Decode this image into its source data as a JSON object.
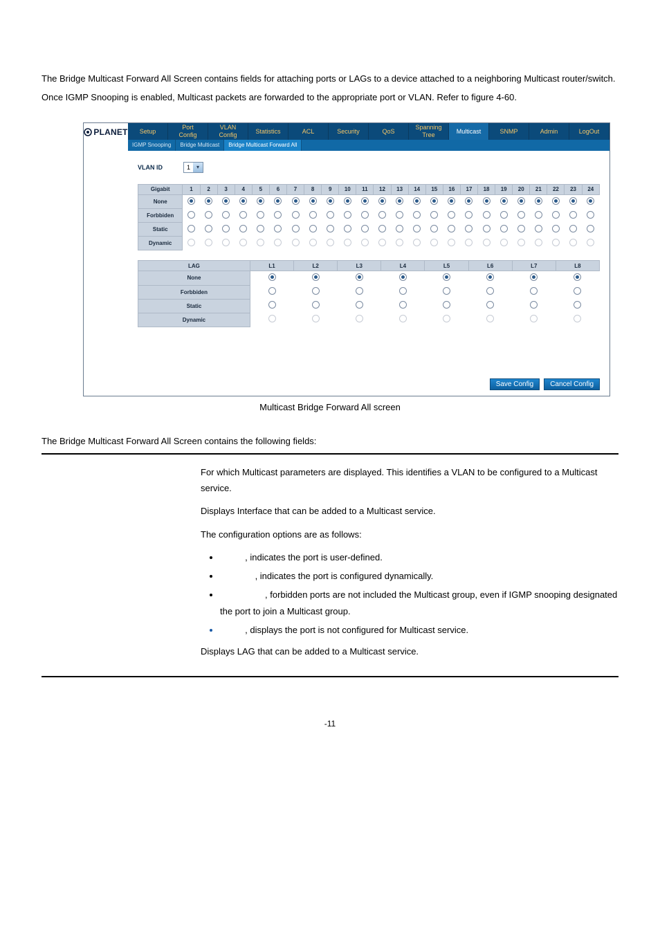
{
  "intro": "The Bridge Multicast Forward All Screen contains fields for attaching ports or LAGs to a device attached to a neighboring Multicast router/switch. Once IGMP Snooping is enabled, Multicast packets are forwarded to the appropriate port or VLAN. Refer to figure 4-60.",
  "logo_text": "PLANET",
  "menubar": [
    "Setup",
    "Port Config",
    "VLAN Config",
    "Statistics",
    "ACL",
    "Security",
    "QoS",
    "Spanning Tree",
    "Multicast",
    "SNMP",
    "Admin",
    "LogOut"
  ],
  "menubar_active": 8,
  "submenubar": [
    "IGMP Snooping",
    "Bridge Multicast",
    "Bridge Multicast Forward All"
  ],
  "submenubar_active": 2,
  "vlan_label": "VLAN ID",
  "vlan_value": "1",
  "gigabit_header": "Gigabit",
  "lag_header": "LAG",
  "row_labels": [
    "None",
    "Forbbiden",
    "Static",
    "Dynamic"
  ],
  "gigabit_cols": 24,
  "gigabit_selected_row": 0,
  "gigabit_disabled_row": 3,
  "lag_cols": 8,
  "lag_col_prefix": "L",
  "lag_selected_row": 0,
  "lag_disabled_row": 3,
  "buttons": {
    "save": "Save Config",
    "cancel": "Cancel Config"
  },
  "caption": "Multicast Bridge Forward All screen",
  "fields_intro": "The Bridge Multicast Forward All Screen contains the following fields:",
  "defs": {
    "d1": "For which Multicast parameters are displayed. This identifies a VLAN to be configured to a Multicast service.",
    "d2": "Displays Interface that can be added to a Multicast service.",
    "d2b": "The configuration options are as follows:",
    "opts": [
      ", indicates the port is user-defined.",
      ", indicates the port is configured dynamically.",
      ", forbidden ports are not included the Multicast group, even if IGMP snooping designated the port to join a Multicast group.",
      ", displays the port is not configured for Multicast service."
    ],
    "d3": "Displays LAG that can be added to a Multicast service."
  },
  "page_number": "-11"
}
